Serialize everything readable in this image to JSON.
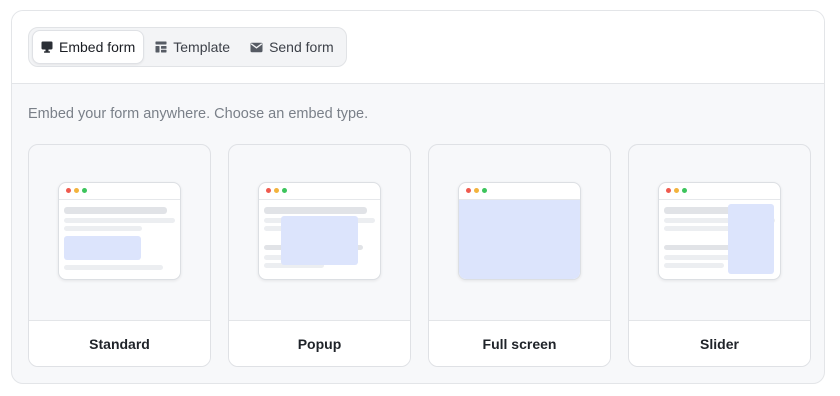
{
  "tabs": [
    {
      "label": "Embed form",
      "icon": "monitor-icon",
      "active": true
    },
    {
      "label": "Template",
      "icon": "layout-icon",
      "active": false
    },
    {
      "label": "Send form",
      "icon": "mail-icon",
      "active": false
    }
  ],
  "description": "Embed your form anywhere. Choose an embed type.",
  "cards": [
    {
      "label": "Standard"
    },
    {
      "label": "Popup"
    },
    {
      "label": "Full screen"
    },
    {
      "label": "Slider"
    }
  ],
  "colors": {
    "accent_block": "#dce4fc",
    "dot_red": "#ef5a4e",
    "dot_yellow": "#f2b33d",
    "dot_green": "#3cc45c"
  }
}
